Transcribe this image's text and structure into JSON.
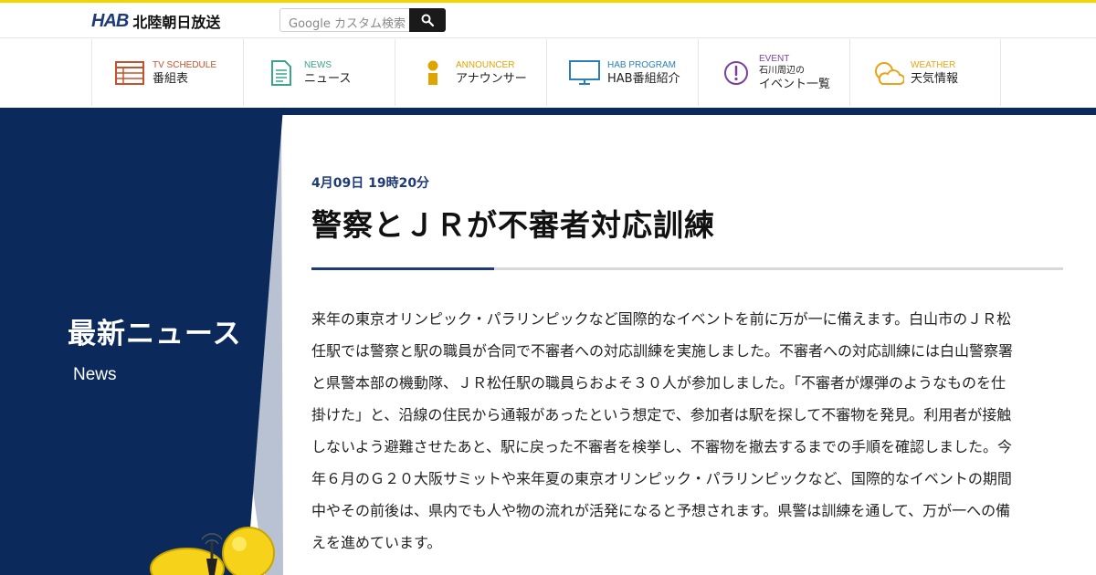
{
  "header": {
    "logo_mark": "HAB",
    "logo_text": "北陸朝日放送",
    "search_placeholder": "Google カスタム検索"
  },
  "nav": [
    {
      "en": "TV SCHEDULE",
      "ja": "番組表",
      "icon": "calendar-grid-icon",
      "color": "#c8502a"
    },
    {
      "en": "NEWS",
      "ja": "ニュース",
      "icon": "document-icon",
      "color": "#3aa58c"
    },
    {
      "en": "ANNOUNCER",
      "ja": "アナウンサー",
      "icon": "person-icon",
      "color": "#e0a400"
    },
    {
      "en": "HAB PROGRAM",
      "ja": "HAB番組紹介",
      "icon": "tv-monitor-icon",
      "color": "#2a7fb8"
    },
    {
      "en": "EVENT",
      "ja_small": "石川周辺の",
      "ja": "イベント一覧",
      "icon": "alert-circle-icon",
      "color": "#7b3f9e"
    },
    {
      "en": "WEATHER",
      "ja": "天気情報",
      "icon": "sun-cloud-icon",
      "color": "#e8a317"
    }
  ],
  "hero": {
    "title": "最新ニュース",
    "subtitle": "News"
  },
  "article": {
    "date": "4月09日 19時20分",
    "title": "警察とＪＲが不審者対応訓練",
    "body": "来年の東京オリンピック・パラリンピックなど国際的なイベントを前に万が一に備えます。白山市のＪＲ松任駅では警察と駅の職員が合同で不審者への対応訓練を実施しました。不審者への対応訓練には白山警察署と県警本部の機動隊、ＪＲ松任駅の職員らおよそ３０人が参加しました。「不審者が爆弾のようなものを仕掛けた」と、沿線の住民から通報があったという想定で、参加者は駅を探して不審物を発見。利用者が接触しないよう避難させたあと、駅に戻った不審者を検挙し、不審物を撤去するまでの手順を確認しました。今年６月のＧ２０大阪サミットや来年夏の東京オリンピック・パラリンピックなど、国際的なイベントの期間中やその前後は、県内でも人や物の流れが活発になると予想されます。県警は訓練を通して、万が一への備えを進めています。"
  },
  "colors": {
    "navy": "#0b2a5b",
    "accent_yellow": "#f2d400",
    "brand_blue": "#1f3a78"
  }
}
